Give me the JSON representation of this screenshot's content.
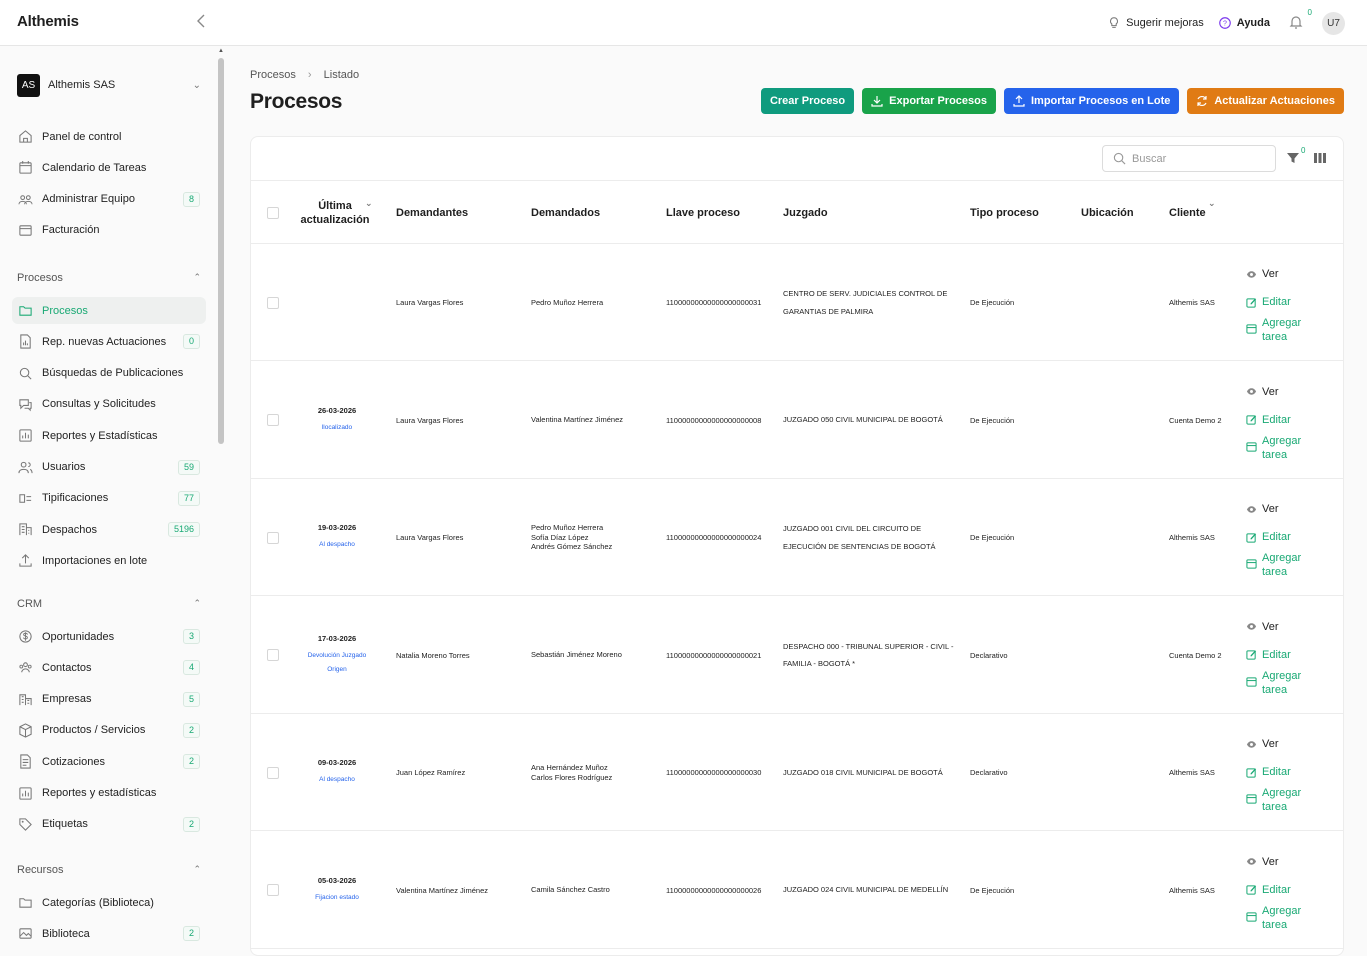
{
  "header": {
    "brand": "Althemis",
    "suggest_label": "Sugerir mejoras",
    "help_label": "Ayuda",
    "notif_count": "0",
    "user_initials": "U7"
  },
  "sidebar": {
    "org_badge": "AS",
    "org_name": "Althemis SAS",
    "top_items": [
      {
        "label": "Panel de control",
        "icon": "home-icon"
      },
      {
        "label": "Calendario de Tareas",
        "icon": "calendar-icon"
      },
      {
        "label": "Administrar Equipo",
        "icon": "team-icon",
        "badge": "8"
      },
      {
        "label": "Facturación",
        "icon": "billing-icon"
      }
    ],
    "section_procesos": "Procesos",
    "procesos_items": [
      {
        "label": "Procesos",
        "icon": "folder-icon",
        "active": true
      },
      {
        "label": "Rep. nuevas Actuaciones",
        "icon": "report-icon",
        "badge": "0"
      },
      {
        "label": "Búsquedas de Publicaciones",
        "icon": "search-icon"
      },
      {
        "label": "Consultas y Solicitudes",
        "icon": "chat-icon"
      },
      {
        "label": "Reportes y Estadísticas",
        "icon": "chart-icon"
      },
      {
        "label": "Usuarios",
        "icon": "users-icon",
        "badge": "59"
      },
      {
        "label": "Tipificaciones",
        "icon": "tag-list-icon",
        "badge": "77"
      },
      {
        "label": "Despachos",
        "icon": "building-icon",
        "badge": "5196"
      },
      {
        "label": "Importaciones en lote",
        "icon": "upload-icon"
      }
    ],
    "section_crm": "CRM",
    "crm_items": [
      {
        "label": "Oportunidades",
        "icon": "dollar-icon",
        "badge": "3"
      },
      {
        "label": "Contactos",
        "icon": "contacts-icon",
        "badge": "4"
      },
      {
        "label": "Empresas",
        "icon": "company-icon",
        "badge": "5"
      },
      {
        "label": "Productos / Servicios",
        "icon": "box-icon",
        "badge": "2"
      },
      {
        "label": "Cotizaciones",
        "icon": "quote-icon",
        "badge": "2"
      },
      {
        "label": "Reportes y estadísticas",
        "icon": "chart-icon"
      },
      {
        "label": "Etiquetas",
        "icon": "tag-icon",
        "badge": "2"
      }
    ],
    "section_recursos": "Recursos",
    "recursos_items": [
      {
        "label": "Categorías (Biblioteca)",
        "icon": "folder-icon"
      },
      {
        "label": "Biblioteca",
        "icon": "image-icon",
        "badge": "2"
      }
    ]
  },
  "main": {
    "breadcrumb": [
      "Procesos",
      "Listado"
    ],
    "title": "Procesos",
    "buttons": {
      "create": "Crear Proceso",
      "export": "Exportar Procesos",
      "import": "Importar Procesos en Lote",
      "update": "Actualizar Actuaciones"
    },
    "search_placeholder": "Buscar",
    "filter_count": "0",
    "columns": {
      "last_update_1": "Última",
      "last_update_2": "actualización",
      "plaintiffs": "Demandantes",
      "defendants": "Demandados",
      "key": "Llave proceso",
      "court": "Juzgado",
      "type": "Tipo proceso",
      "location": "Ubicación",
      "client": "Cliente"
    },
    "actions": {
      "view": "Ver",
      "edit": "Editar",
      "task_1": "Agregar",
      "task_2": "tarea"
    },
    "rows": [
      {
        "date": "",
        "status": [],
        "plaintiffs": [
          "Laura Vargas Flores"
        ],
        "defendants": [
          "Pedro Muñoz Herrera"
        ],
        "key": "11000000000000000000031",
        "court": "CENTRO DE SERV. JUDICIALES CONTROL DE GARANTIAS DE PALMIRA",
        "type": "De Ejecución",
        "client": "Althemis SAS"
      },
      {
        "date": "26-03-2026",
        "status": [
          "llocalizado"
        ],
        "plaintiffs": [
          "Laura Vargas Flores"
        ],
        "defendants": [
          "Valentina Martínez Jiménez"
        ],
        "key": "11000000000000000000008",
        "court": "JUZGADO 050 CIVIL MUNICIPAL DE BOGOTÁ",
        "type": "De Ejecución",
        "client": "Cuenta Demo 2"
      },
      {
        "date": "19-03-2026",
        "status": [
          "Al despacho"
        ],
        "plaintiffs": [
          "Laura Vargas Flores"
        ],
        "defendants": [
          "Pedro Muñoz Herrera",
          "Sofía Díaz López",
          "Andrés Gómez Sánchez"
        ],
        "key": "11000000000000000000024",
        "court": "JUZGADO 001 CIVIL DEL CIRCUITO DE EJECUCIÓN DE SENTENCIAS DE BOGOTÁ",
        "type": "De Ejecución",
        "client": "Althemis SAS"
      },
      {
        "date": "17-03-2026",
        "status": [
          "Devolución Juzgado",
          "Origen"
        ],
        "plaintiffs": [
          "Natalia Moreno Torres"
        ],
        "defendants": [
          "Sebastián Jiménez Moreno"
        ],
        "key": "11000000000000000000021",
        "court": "DESPACHO 000 - TRIBUNAL SUPERIOR - CIVIL - FAMILIA - BOGOTÁ *",
        "type": "Declarativo",
        "client": "Cuenta Demo 2"
      },
      {
        "date": "09-03-2026",
        "status": [
          "Al despacho"
        ],
        "plaintiffs": [
          "Juan López Ramírez"
        ],
        "defendants": [
          "Ana Hernández Muñoz",
          "Carlos Flores Rodríguez"
        ],
        "key": "11000000000000000000030",
        "court": "JUZGADO 018 CIVIL MUNICIPAL DE BOGOTÁ",
        "type": "Declarativo",
        "client": "Althemis SAS"
      },
      {
        "date": "05-03-2026",
        "status": [
          "Fijacion estado"
        ],
        "plaintiffs": [
          "Valentina Martínez Jiménez"
        ],
        "defendants": [
          "Camila Sánchez Castro"
        ],
        "key": "11000000000000000000026",
        "court": "JUZGADO 024 CIVIL MUNICIPAL DE MEDELLÍN",
        "type": "De Ejecución",
        "client": "Althemis SAS"
      }
    ]
  },
  "colors": {
    "accent": "#19a974",
    "teal": "#0f9b7e",
    "green": "#19a34a",
    "blue": "#2563eb",
    "orange": "#e07b14"
  }
}
